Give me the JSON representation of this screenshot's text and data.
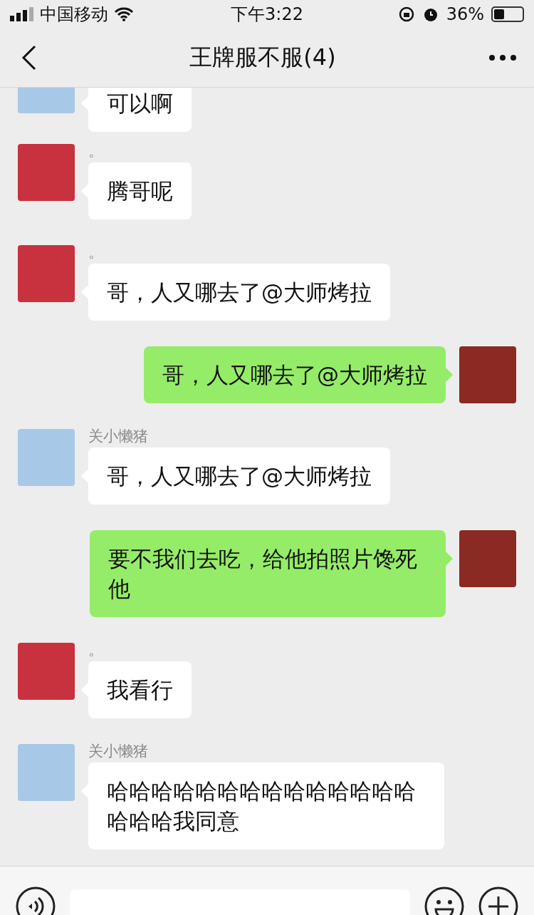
{
  "status_bar": {
    "carrier": "中国移动",
    "time": "下午3:22",
    "battery": "36%",
    "battery_meter": {
      "level": 0.36
    }
  },
  "header": {
    "title": "王牌服不服(4)"
  },
  "messages": [
    {
      "kind": "received",
      "color": "#a8c8e8",
      "text": "可以啊"
    },
    {
      "kind": "received",
      "sender": "。",
      "color": "#c8323e",
      "text": "腾哥呢"
    },
    {
      "kind": "received",
      "sender": "。",
      "color": "#c8323e",
      "text": "哥，人又哪去了@大师烤拉"
    },
    {
      "kind": "sent",
      "color": "#8a2a22",
      "text": "哥，人又哪去了@大师烤拉"
    },
    {
      "kind": "received",
      "sender": "关小懒猪",
      "color": "#a8c8e8",
      "text": "哥，人又哪去了@大师烤拉"
    },
    {
      "kind": "sent",
      "color": "#8a2a22",
      "text": "要不我们去吃，给他拍照片馋死他"
    },
    {
      "kind": "received",
      "sender": "。",
      "color": "#c8323e",
      "text": "我看行"
    },
    {
      "kind": "received",
      "sender": "关小懒猪",
      "color": "#a8c8e8",
      "text": "哈哈哈哈哈哈哈哈哈哈哈哈哈哈哈哈哈我同意"
    }
  ]
}
